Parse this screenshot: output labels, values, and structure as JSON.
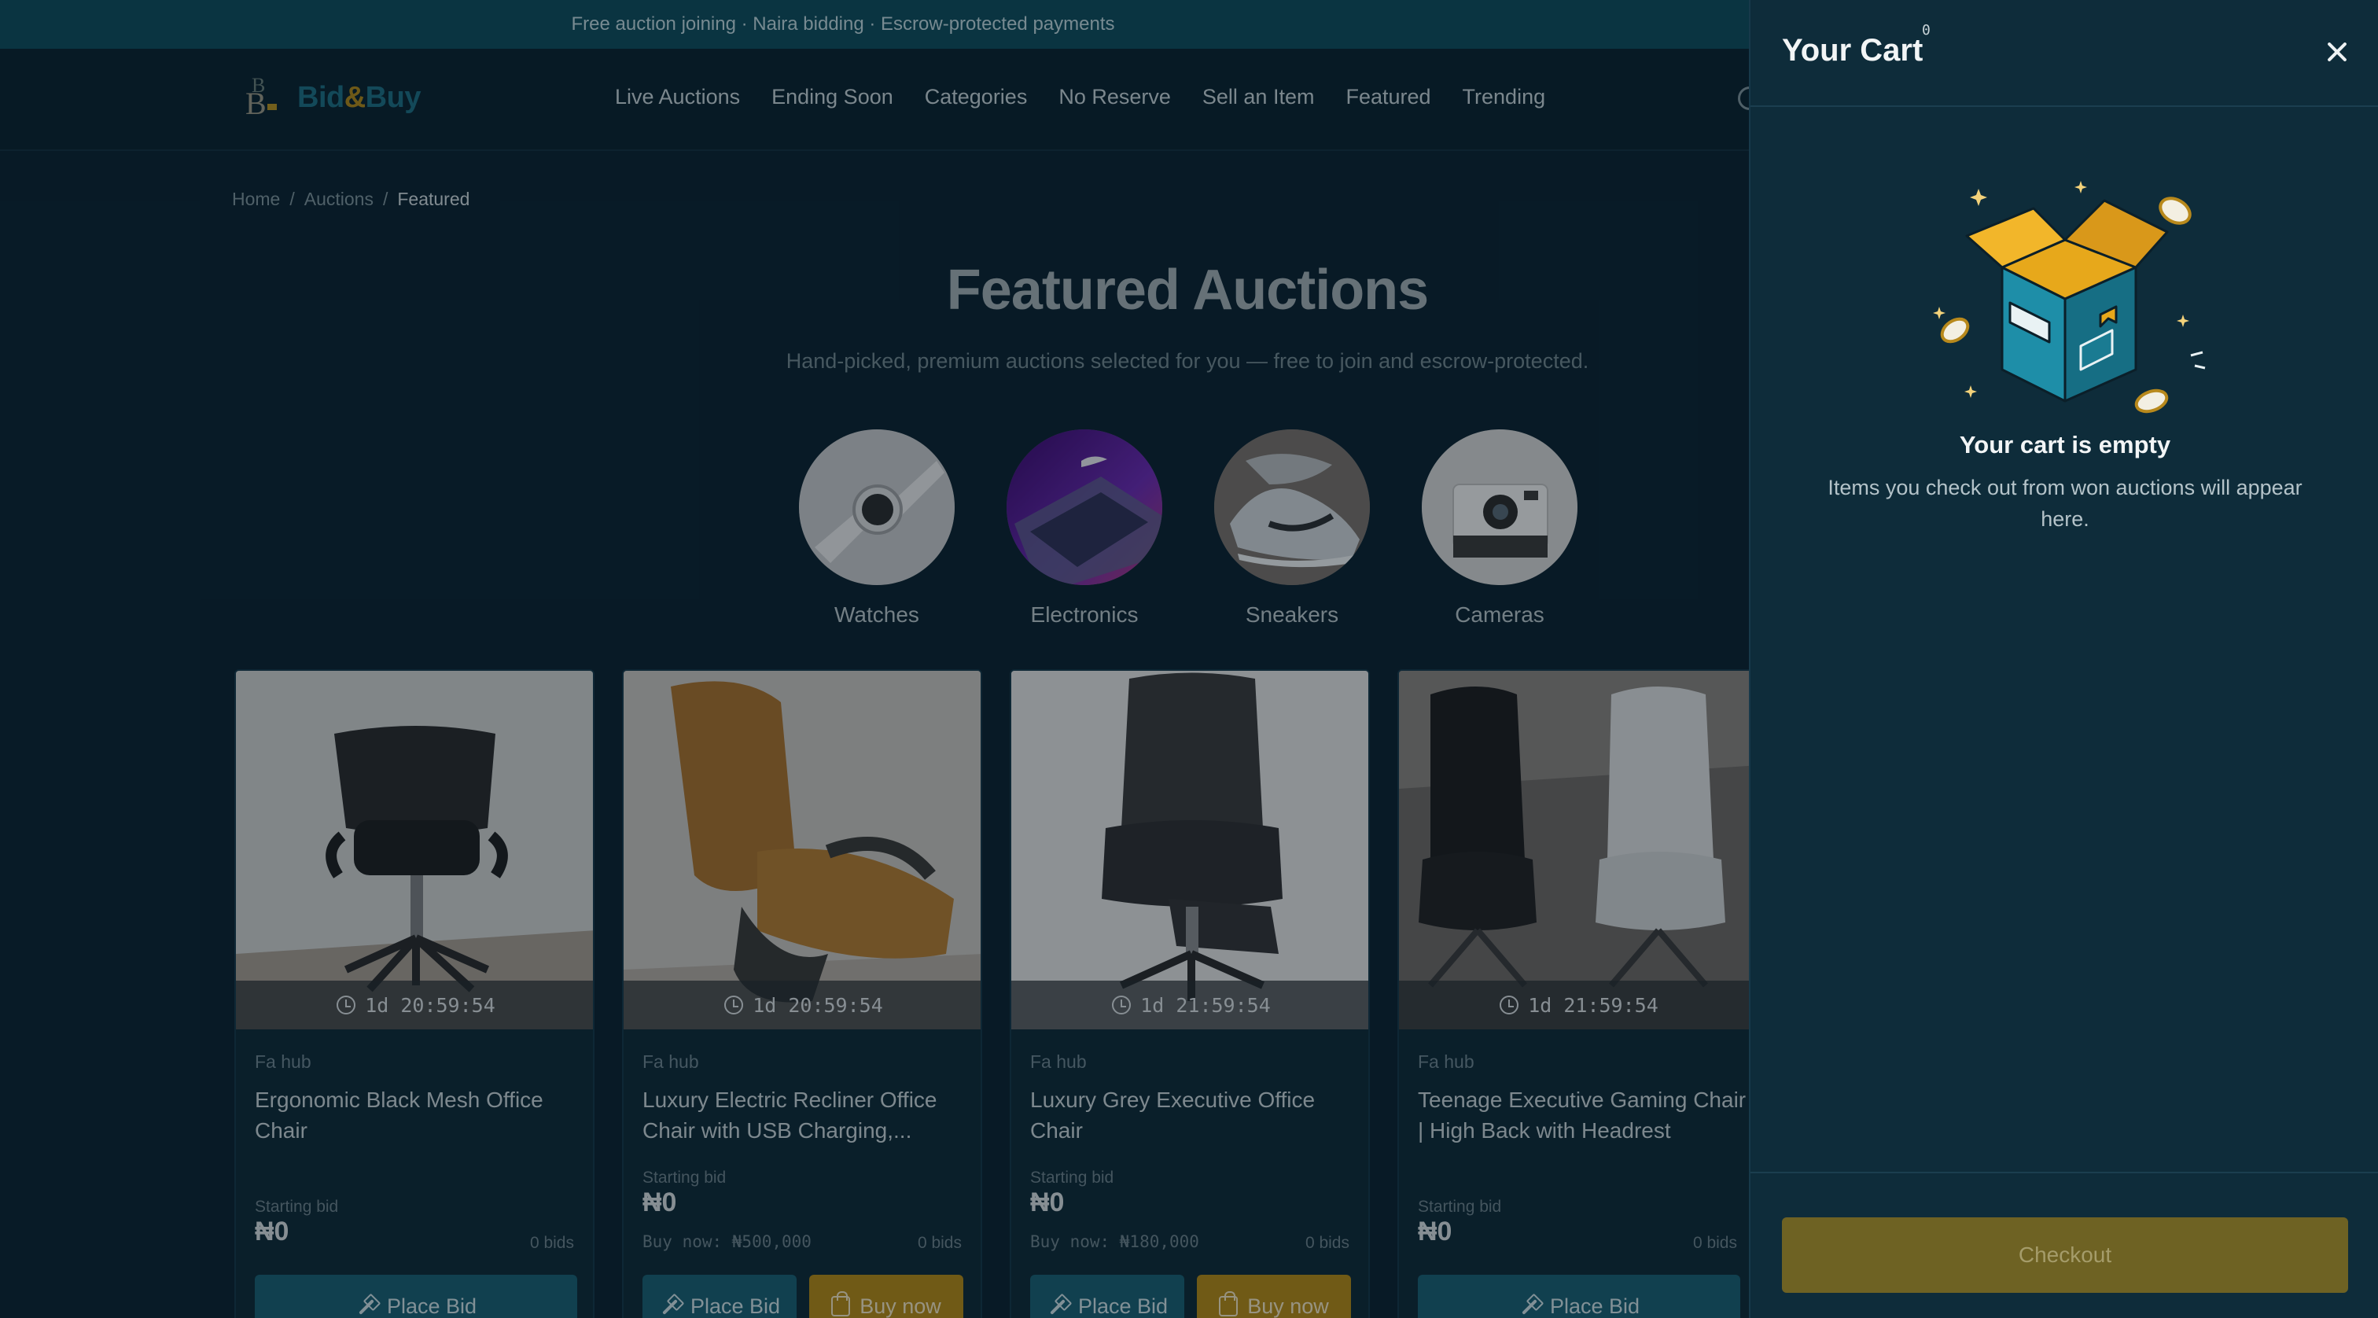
{
  "announcement": "Free auction joining · Naira bidding · Escrow-protected payments",
  "brand": {
    "name_part1": "Bid",
    "amp": "&",
    "name_part2": "Buy",
    "mark": "B"
  },
  "nav": [
    "Live Auctions",
    "Ending Soon",
    "Categories",
    "No Reserve",
    "Sell an Item",
    "Featured",
    "Trending"
  ],
  "breadcrumb": {
    "home": "Home",
    "sep": "/",
    "auctions": "Auctions",
    "current": "Featured"
  },
  "page": {
    "title": "Featured Auctions",
    "subtitle": "Hand-picked, premium auctions selected for you — free to join and escrow-protected."
  },
  "categories": [
    {
      "label": "Watches",
      "icon": "smartwatch-photo"
    },
    {
      "label": "Electronics",
      "icon": "laptop-photo"
    },
    {
      "label": "Sneakers",
      "icon": "sneaker-photo"
    },
    {
      "label": "Cameras",
      "icon": "instant-camera-photo"
    }
  ],
  "cards": [
    {
      "timer": "1d 20:59:54",
      "seller": "Fa hub",
      "name": "Ergonomic Black Mesh Office Chair",
      "starting_label": "Starting bid",
      "price": "₦0",
      "buy_now": "",
      "bids": "0 bids",
      "bid_label": "Place Bid",
      "buy_label": ""
    },
    {
      "timer": "1d 20:59:54",
      "seller": "Fa hub",
      "name": "Luxury Electric Recliner Office Chair with USB Charging,...",
      "starting_label": "Starting bid",
      "price": "₦0",
      "buy_now": "Buy now: ₦500,000",
      "bids": "0 bids",
      "bid_label": "Place Bid",
      "buy_label": "Buy now"
    },
    {
      "timer": "1d 21:59:54",
      "seller": "Fa hub",
      "name": "Luxury Grey Executive Office Chair",
      "starting_label": "Starting bid",
      "price": "₦0",
      "buy_now": "Buy now: ₦180,000",
      "bids": "0 bids",
      "bid_label": "Place Bid",
      "buy_label": "Buy now"
    },
    {
      "timer": "1d 21:59:54",
      "seller": "Fa hub",
      "name": "Teenage Executive Gaming Chair | High Back with Headrest",
      "starting_label": "Starting bid",
      "price": "₦0",
      "buy_now": "",
      "bids": "0 bids",
      "bid_label": "Place Bid",
      "buy_label": ""
    }
  ],
  "cart": {
    "title": "Your Cart",
    "count": "0",
    "empty_title": "Your cart is empty",
    "empty_desc": "Items you check out from won auctions will appear here.",
    "checkout_label": "Checkout"
  },
  "colors": {
    "accent_teal": "#1a5f73",
    "accent_gold": "#b48a17",
    "background": "#0c2331",
    "drawer": "#0e2c3a"
  }
}
